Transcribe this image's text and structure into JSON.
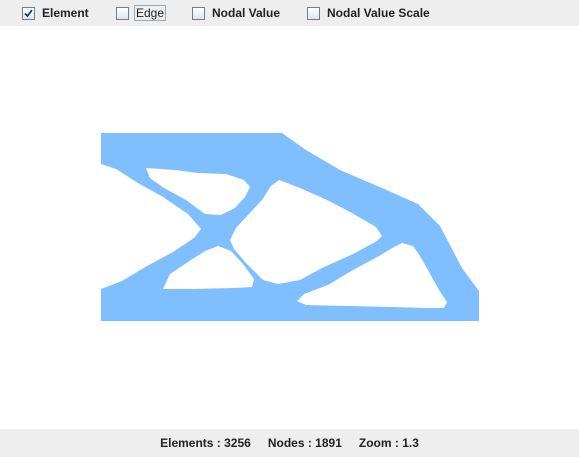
{
  "toolbar": {
    "checkboxes": [
      {
        "label": "Element",
        "checked": true
      },
      {
        "label": "Edge",
        "checked": false
      },
      {
        "label": "Nodal Value",
        "checked": false
      },
      {
        "label": "Nodal Value Scale",
        "checked": false
      }
    ]
  },
  "model": {
    "fill_color": "#80bfff"
  },
  "status": {
    "elements": "Elements : 3256",
    "nodes": "Nodes : 1891",
    "zoom": "Zoom : 1.3"
  }
}
